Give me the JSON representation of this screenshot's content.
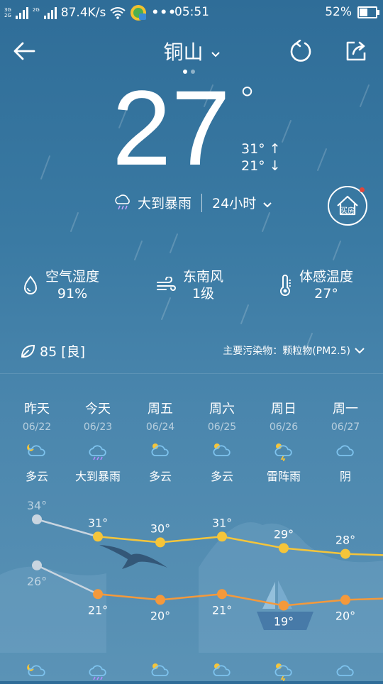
{
  "status_bar": {
    "net_top": "3G",
    "net_bottom": "2G",
    "net2_top": "2G",
    "speed": "87.4K/s",
    "more": "•••",
    "time": "05:51",
    "battery": "52%"
  },
  "header": {
    "city": "铜山",
    "chevron": "⌄"
  },
  "current": {
    "temp": "27",
    "deg": "°",
    "high": "31° ↑",
    "low": "21° ↓",
    "condition": "大到暴雨",
    "hours": "24小时",
    "house_label": "买房"
  },
  "metrics": {
    "humidity_label": "空气湿度",
    "humidity_value": "91%",
    "wind_label": "东南风",
    "wind_value": "1级",
    "feels_label": "体感温度",
    "feels_value": "27°"
  },
  "air": {
    "aqi": "85 [良]",
    "pollutant": "主要污染物：颗粒物(PM2.5)"
  },
  "forecast": [
    {
      "day": "昨天",
      "date": "06/22",
      "cond": "多云",
      "icon": "partly-cloudy-night-icon"
    },
    {
      "day": "今天",
      "date": "06/23",
      "cond": "大到暴雨",
      "icon": "rain-icon"
    },
    {
      "day": "周五",
      "date": "06/24",
      "cond": "多云",
      "icon": "partly-cloudy-icon"
    },
    {
      "day": "周六",
      "date": "06/25",
      "cond": "多云",
      "icon": "partly-cloudy-icon"
    },
    {
      "day": "周日",
      "date": "06/26",
      "cond": "雷阵雨",
      "icon": "thunderstorm-icon"
    },
    {
      "day": "周一",
      "date": "06/27",
      "cond": "阴",
      "icon": "cloud-icon"
    }
  ],
  "chart_data": {
    "type": "line",
    "categories": [
      "昨天",
      "今天",
      "周五",
      "周六",
      "周日",
      "周一"
    ],
    "series": [
      {
        "values": [
          34,
          31,
          30,
          31,
          29,
          28
        ],
        "color": "#f5c53a"
      },
      {
        "values": [
          26,
          21,
          20,
          21,
          19,
          20
        ],
        "color": "#f4993b"
      }
    ],
    "high_labels": [
      "34°",
      "31°",
      "30°",
      "31°",
      "29°",
      "28°"
    ],
    "low_labels": [
      "26°",
      "21°",
      "20°",
      "21°",
      "19°",
      "20°"
    ],
    "past_color": "#c9d5e0"
  }
}
